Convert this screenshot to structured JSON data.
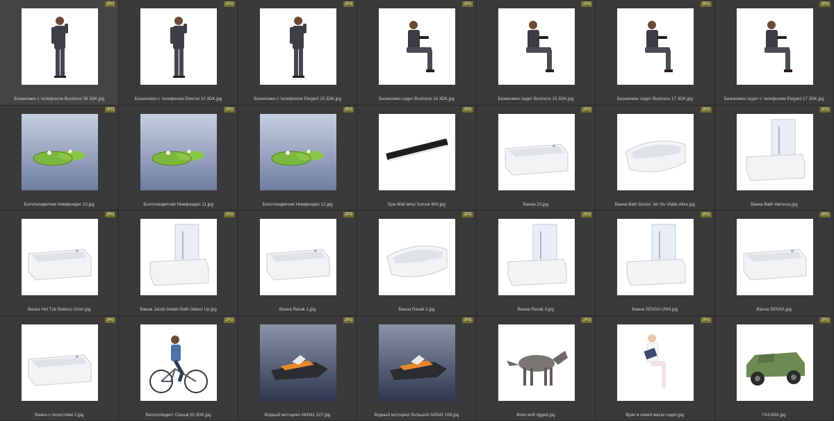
{
  "badge_label": "JPG",
  "items": [
    {
      "caption": "Бизнесмен с телефоном Business 08 3DK.jpg",
      "icon": "man-phone"
    },
    {
      "caption": "Бизнесмен с телефоном Diverse 10 3DK.jpg",
      "icon": "man-phone"
    },
    {
      "caption": "Бизнесмен с телефоном Elegant 15 3DK.jpg",
      "icon": "man-phone"
    },
    {
      "caption": "Бизнесмен сидит Business 14 3DK.jpg",
      "icon": "man-sitting"
    },
    {
      "caption": "Бизнесмен сидит Business 15 3DK.jpg",
      "icon": "man-sitting"
    },
    {
      "caption": "Бизнесмен сидит Business 17 3DK.jpg",
      "icon": "man-sitting"
    },
    {
      "caption": "Бизнесмен сидит с телефоном Elegant 17 3DK.jpg",
      "icon": "man-sitting"
    },
    {
      "caption": "Болотноцветник Нимфоидес 10.jpg",
      "icon": "lily-pads"
    },
    {
      "caption": "Болотноцветник Нимфоидес 11.jpg",
      "icon": "lily-pads"
    },
    {
      "caption": "Болотноцветник Нимфоидес 12.jpg",
      "icon": "lily-pads"
    },
    {
      "caption": "Бра Wall lamp Sunset 600.jpg",
      "icon": "wall-lamp"
    },
    {
      "caption": "Ванна 20.jpg",
      "icon": "bathtub"
    },
    {
      "caption": "Ванна Bath Doctor Jet Vis Vitalis Alice.jpg",
      "icon": "bathtub-corner"
    },
    {
      "caption": "Ванна Bath Vanessa.jpg",
      "icon": "bathtub-screen"
    },
    {
      "caption": "Ванна Hot Tub Balteco Orion.jpg",
      "icon": "bathtub"
    },
    {
      "caption": "Ванна Jacob Delafo Bath Odeon Up.jpg",
      "icon": "bathtub-screen"
    },
    {
      "caption": "Ванна Ravak 1.jpg",
      "icon": "bathtub"
    },
    {
      "caption": "Ванна Ravak 2.jpg",
      "icon": "bathtub-corner"
    },
    {
      "caption": "Ванна Ravak 3.jpg",
      "icon": "bathtub-screen"
    },
    {
      "caption": "Ванна SENSA UNI4.jpg",
      "icon": "bathtub-screen"
    },
    {
      "caption": "Ванна SENSA.jpg",
      "icon": "bathtub"
    },
    {
      "caption": "Ванна с полостями 2.jpg",
      "icon": "bathtub"
    },
    {
      "caption": "Велосипедист Casual 05 3DK.jpg",
      "icon": "cyclist"
    },
    {
      "caption": "Водный мотоцикл AM341 027.jpg",
      "icon": "jet-ski"
    },
    {
      "caption": "Водный мотоцикл большой AM341 028.jpg",
      "icon": "jet-ski"
    },
    {
      "caption": "Волк wolf rigged.jpg",
      "icon": "wolf"
    },
    {
      "caption": "Врач в синей маске сидит.jpg",
      "icon": "doctor-sitting"
    },
    {
      "caption": "ГАЗ-69А.jpg",
      "icon": "jeep"
    }
  ]
}
